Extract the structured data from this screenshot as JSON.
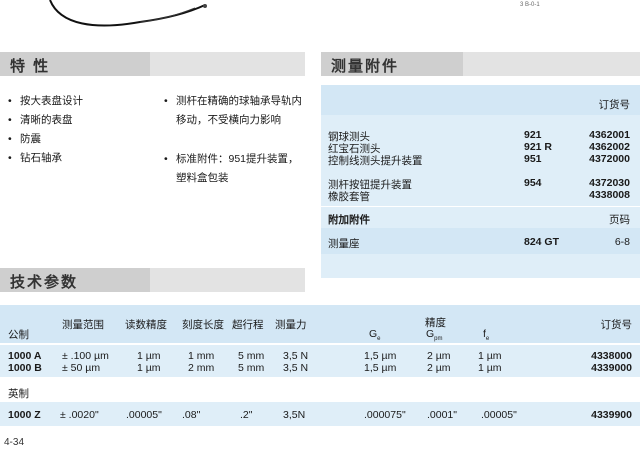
{
  "figure": {
    "label": "3 B-0-1"
  },
  "features": {
    "title": "特 性",
    "left": [
      "按大表盘设计",
      "清晰的表盘",
      "防震",
      "钻石轴承"
    ],
    "right": [
      [
        "测杆在精确的球轴承导轨内",
        "移动，不受横向力影响"
      ],
      [
        "标准附件：951提升装置，",
        "塑料盒包装"
      ]
    ]
  },
  "accessories": {
    "title": "测量附件",
    "order_header": "订货号",
    "items": [
      {
        "name": "钢球测头",
        "code": "921",
        "order": "4362001"
      },
      {
        "name": "红宝石测头",
        "code": "921 R",
        "order": "4362002"
      },
      {
        "name": "控制线测头提升装置",
        "code": "951",
        "order": "4372000"
      },
      {
        "name": "测杆按钮提升装置",
        "code": "954",
        "order": "4372030"
      },
      {
        "name": "橡胶套管",
        "code": "",
        "order": "4338008"
      }
    ],
    "extra_title": "附加附件",
    "page_header": "页码",
    "extra_items": [
      {
        "name": "测量座",
        "code": "824 GT",
        "page": "6-8"
      }
    ]
  },
  "specs": {
    "title": "技术参数",
    "headers": {
      "range": "测量范围",
      "reading": "读数精度",
      "scale": "刻度长度",
      "overtravel": "超行程",
      "force": "测量力",
      "accuracy": "精度",
      "g": "G",
      "g_sub": "e",
      "gpm": "G",
      "gpm_sub": "pm",
      "f": "f",
      "f_sub": "e",
      "order": "订货号"
    },
    "metric_label": "公制",
    "metric_rows": [
      {
        "model": "1000 A",
        "range": "± .100 µm",
        "reading": "1 µm",
        "scale": "1 mm",
        "overtravel": "5 mm",
        "force": "3,5 N",
        "g": "1,5 µm",
        "gpm": "2 µm",
        "f": "1 µm",
        "order": "4338000"
      },
      {
        "model": "1000 B",
        "range": "± 50 µm",
        "reading": "1 µm",
        "scale": "2 mm",
        "overtravel": "5 mm",
        "force": "3,5 N",
        "g": "1,5 µm",
        "gpm": "2 µm",
        "f": "1 µm",
        "order": "4339000"
      }
    ],
    "imperial_label": "英制",
    "imperial_rows": [
      {
        "model": "1000 Z",
        "range": "± .0020\"",
        "reading": ".00005\"",
        "scale": ".08\"",
        "overtravel": ".2\"",
        "force": "3,5N",
        "g": ".000075\"",
        "gpm": ".0001\"",
        "f": ".00005\"",
        "order": "4339900"
      }
    ]
  },
  "page_number": "4-34"
}
